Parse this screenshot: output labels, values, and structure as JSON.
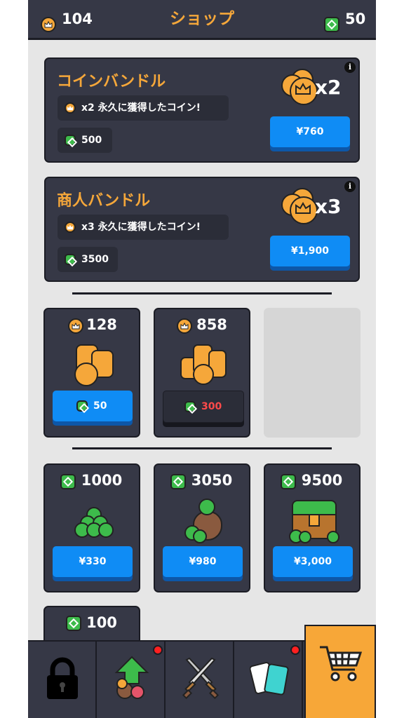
{
  "header": {
    "title": "ショップ",
    "coins": "104",
    "gems": "50"
  },
  "bundles": [
    {
      "title": "コインバンドル",
      "perk": "x2 永久に獲得したコイン!",
      "gem_cost": "500",
      "price": "¥760",
      "multiplier": "x2"
    },
    {
      "title": "商人バンドル",
      "perk": "x3 永久に獲得したコイン!",
      "gem_cost": "3500",
      "price": "¥1,900",
      "multiplier": "x3"
    }
  ],
  "coin_packs": [
    {
      "amount": "128",
      "cost": "50",
      "affordable": true
    },
    {
      "amount": "858",
      "cost": "300",
      "affordable": false
    }
  ],
  "gem_packs": [
    {
      "amount": "1000",
      "price": "¥330"
    },
    {
      "amount": "3050",
      "price": "¥980"
    },
    {
      "amount": "9500",
      "price": "¥3,000"
    }
  ],
  "partial_pack": {
    "amount": "100"
  },
  "info_label": "i",
  "nav": [
    {
      "name": "lock-tab",
      "icon": "lock-icon",
      "badge": false
    },
    {
      "name": "upgrade-tab",
      "icon": "upgrade-arrow-icon",
      "badge": true
    },
    {
      "name": "battle-tab",
      "icon": "crossed-swords-icon",
      "badge": false
    },
    {
      "name": "cards-tab",
      "icon": "cards-icon",
      "badge": true
    },
    {
      "name": "shop-tab",
      "icon": "shopping-cart-icon",
      "badge": false,
      "active": true
    }
  ],
  "colors": {
    "panel": "#363846",
    "accent": "#f5a73a",
    "gem": "#3dbb4b",
    "button": "#0f8cf5",
    "unaffordable": "#ff4a4a",
    "bg": "#e6e6e6"
  }
}
